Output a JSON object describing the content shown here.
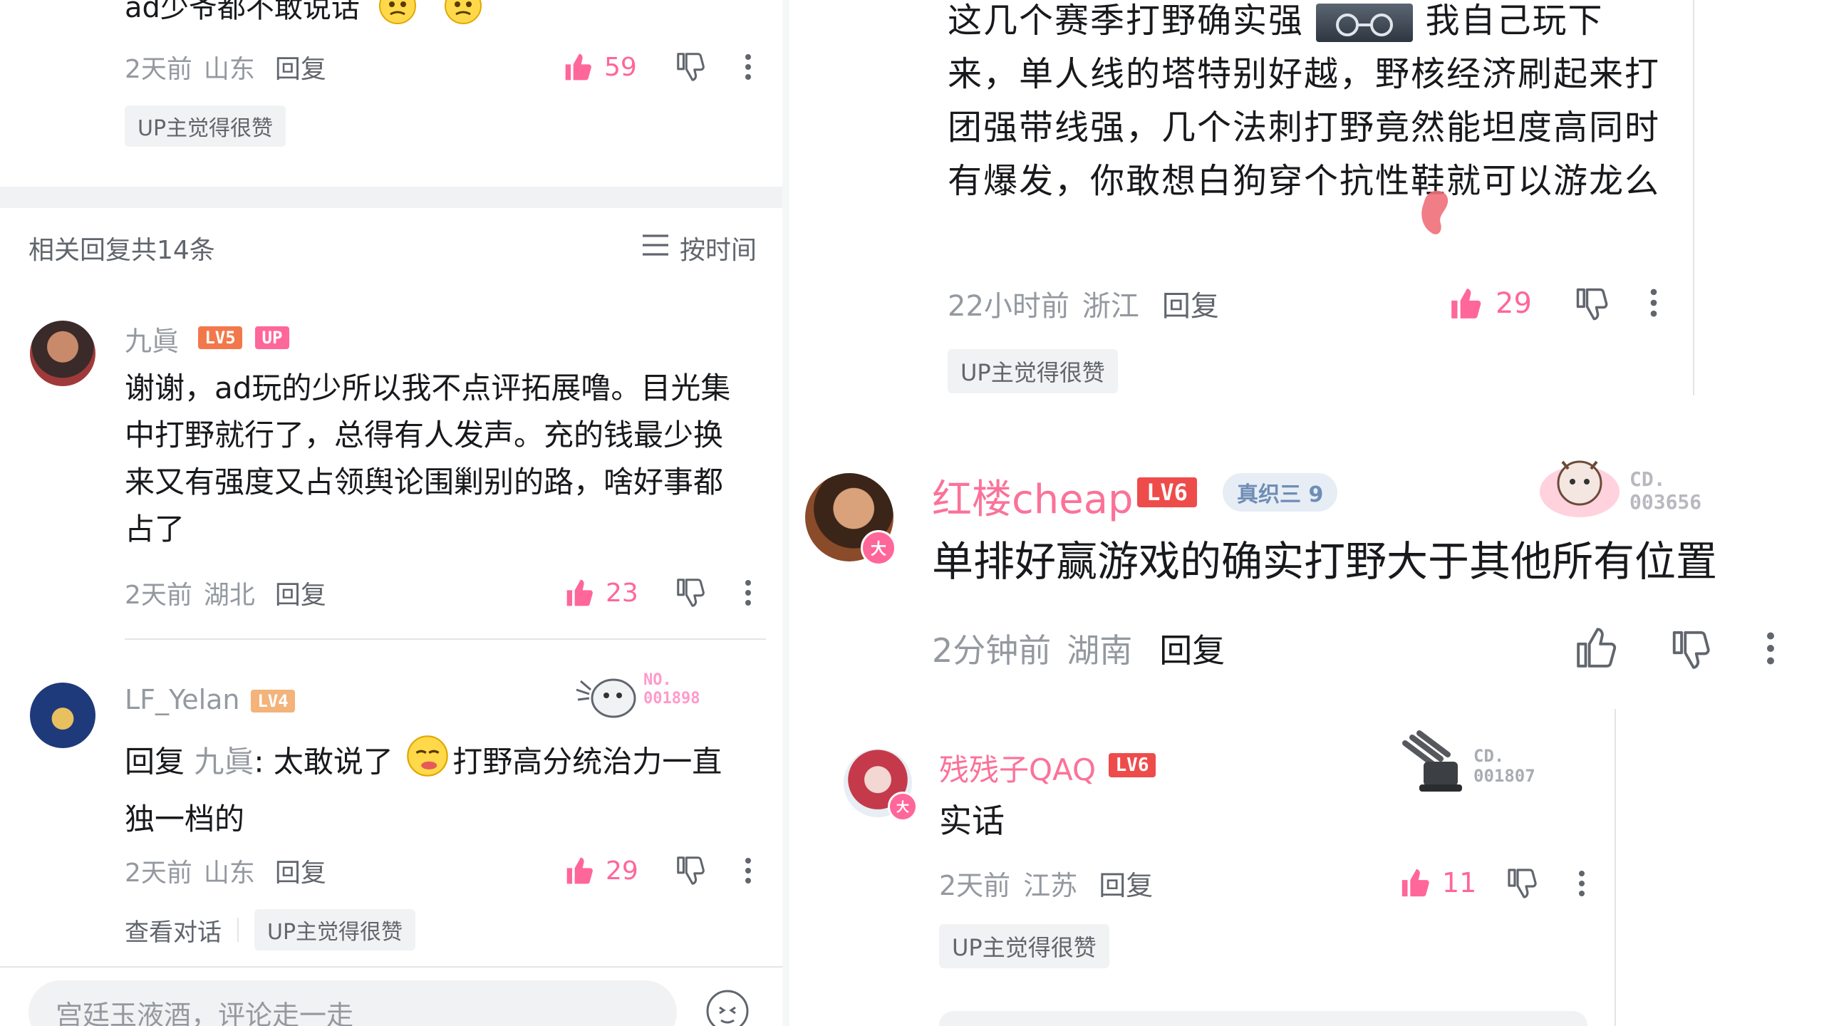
{
  "left": {
    "top_comment": {
      "text_partial": "ad少爷都不敢说话",
      "time": "2天前",
      "location": "山东",
      "reply_label": "回复",
      "like_count": "59",
      "tag": "UP主觉得很赞"
    },
    "replies_header": {
      "count_label": "相关回复共14条",
      "sort_label": "按时间"
    },
    "reply1": {
      "username": "九眞",
      "level": "LV5",
      "up_badge": "UP",
      "text": "谢谢，ad玩的少所以我不点评拓展噜。目光集中打野就行了，总得有人发声。充的钱最少换来又有强度又占领舆论围剿别的路，啥好事都占了",
      "time": "2天前",
      "location": "湖北",
      "reply_label": "回复",
      "like_count": "23"
    },
    "reply2": {
      "username": "LF_Yelan",
      "level": "LV4",
      "fan_badge_no": "NO.",
      "fan_badge_num": "001898",
      "reply_prefix": "回复",
      "reply_to": "九眞",
      "text_a": ": 太敢说了",
      "text_b": "打野高分统治力一直独一档的",
      "time": "2天前",
      "location": "山东",
      "reply_label": "回复",
      "like_count": "29",
      "view_conversation": "查看对话",
      "tag": "UP主觉得很赞"
    },
    "input": {
      "placeholder": "宫廷玉液酒，评论走一走"
    }
  },
  "right": {
    "top_comment": {
      "text_a": "这几个赛季打野确实强",
      "text_b": "我自己玩下来，单人线的塔特别好越，野核经济刷起来打团强带线强，几个法刺打野竟然能坦度高同时有爆发，你敢想白狗穿个抗性鞋就可以游龙么",
      "time": "22小时前",
      "location": "浙江",
      "reply_label": "回复",
      "like_count": "29",
      "tag": "UP主觉得很赞"
    },
    "comment2": {
      "username": "红楼cheap",
      "level": "LV6",
      "medal": "真织三 9",
      "fan_badge_no": "CD.",
      "fan_badge_num": "003656",
      "text": "单排好赢游戏的确实打野大于其他所有位置",
      "time": "2分钟前",
      "location": "湖南",
      "reply_label": "回复",
      "avatar_badge": "大"
    },
    "comment3": {
      "username": "残残子QAQ",
      "level": "LV6",
      "fan_badge_no": "CD.",
      "fan_badge_num": "001807",
      "text": "实话",
      "time": "2天前",
      "location": "江苏",
      "reply_label": "回复",
      "like_count": "11",
      "tag": "UP主觉得很赞",
      "avatar_badge": "大"
    }
  },
  "colors": {
    "accent_pink": "#ff6699",
    "level_orange": "#f2784b",
    "level_red": "#ee4b4b",
    "level_light": "#f3b37a",
    "text_gray": "#9499a0",
    "tag_bg": "#f1f2f3"
  },
  "icons": [
    "thumbs-up-icon",
    "thumbs-down-icon",
    "more-vertical-icon",
    "sort-lines-icon",
    "emoji-icon"
  ]
}
